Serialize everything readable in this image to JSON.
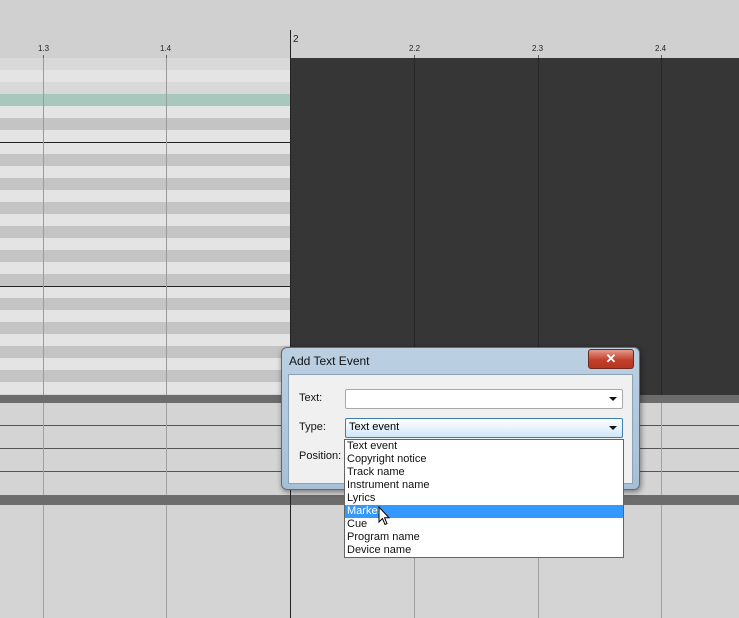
{
  "ruler": {
    "ticks": [
      "1.3",
      "1.4",
      "2",
      "2.2",
      "2.3",
      "2.4"
    ]
  },
  "dialog": {
    "title": "Add Text Event",
    "close_glyph": "✕",
    "text_label": "Text:",
    "text_value": "",
    "type_label": "Type:",
    "type_value": "Text event",
    "position_label": "Position:",
    "type_options": [
      "Text event",
      "Copyright notice",
      "Track name",
      "Instrument name",
      "Lyrics",
      "Marker",
      "Cue",
      "Program name",
      "Device name"
    ],
    "highlighted_option": "Marker"
  },
  "colors": {
    "highlight": "#3399ff",
    "selected_key_row": "#a8c8be",
    "dark_region": "#363636"
  },
  "icons": [
    "close-icon",
    "dropdown-arrow-icon",
    "mouse-pointer-icon"
  ]
}
